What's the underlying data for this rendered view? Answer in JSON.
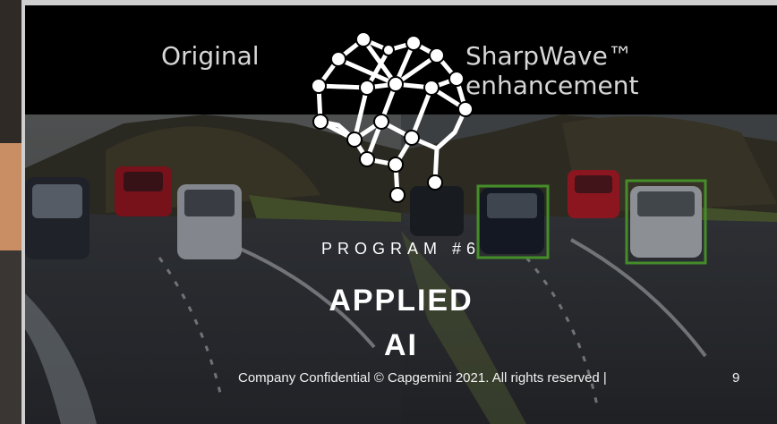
{
  "video": {
    "left_label": "Original",
    "right_label": "SharpWave™ enhancement"
  },
  "icon": "brain-network-icon",
  "program": {
    "label": "PROGRAM #6",
    "title_line1": "APPLIED",
    "title_line2": "AI"
  },
  "footer": {
    "text": "Company Confidential © Capgemini 2021. All rights reserved |",
    "page_number": "9"
  },
  "colors": {
    "detection_box": "#5fc43a",
    "title_text": "#ffffff",
    "top_band": "#000000"
  }
}
